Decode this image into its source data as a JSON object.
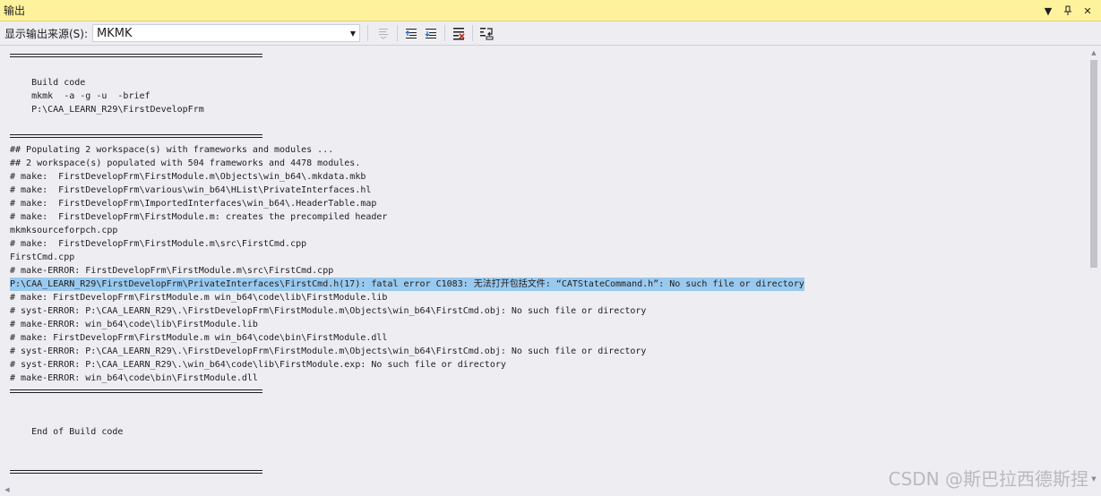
{
  "window": {
    "title": "输出",
    "controls": [
      "▼",
      "ᴨ",
      "✕"
    ]
  },
  "toolbar": {
    "source_label": "显示输出来源(S):",
    "source_value": "MKMK"
  },
  "output": {
    "lines": [
      {
        "type": "rule"
      },
      {
        "type": "blank"
      },
      {
        "type": "text",
        "text": "    Build code"
      },
      {
        "type": "text",
        "text": "    mkmk  -a -g -u  -brief"
      },
      {
        "type": "text",
        "text": "    P:\\CAA_LEARN_R29\\FirstDevelopFrm"
      },
      {
        "type": "blank"
      },
      {
        "type": "rule"
      },
      {
        "type": "text",
        "text": "## Populating 2 workspace(s) with frameworks and modules ..."
      },
      {
        "type": "text",
        "text": "## 2 workspace(s) populated with 504 frameworks and 4478 modules."
      },
      {
        "type": "text",
        "text": "# make:  FirstDevelopFrm\\FirstModule.m\\Objects\\win_b64\\.mkdata.mkb"
      },
      {
        "type": "text",
        "text": "# make:  FirstDevelopFrm\\various\\win_b64\\HList\\PrivateInterfaces.hl"
      },
      {
        "type": "text",
        "text": "# make:  FirstDevelopFrm\\ImportedInterfaces\\win_b64\\.HeaderTable.map"
      },
      {
        "type": "text",
        "text": "# make:  FirstDevelopFrm\\FirstModule.m: creates the precompiled header"
      },
      {
        "type": "text",
        "text": "mkmksourceforpch.cpp"
      },
      {
        "type": "text",
        "text": "# make:  FirstDevelopFrm\\FirstModule.m\\src\\FirstCmd.cpp"
      },
      {
        "type": "text",
        "text": "FirstCmd.cpp"
      },
      {
        "type": "text",
        "text": "# make-ERROR: FirstDevelopFrm\\FirstModule.m\\src\\FirstCmd.cpp"
      },
      {
        "type": "highlight",
        "text": "P:\\CAA_LEARN_R29\\FirstDevelopFrm\\PrivateInterfaces\\FirstCmd.h(17): fatal error C1083: 无法打开包括文件: “CATStateCommand.h”: No such file or directory"
      },
      {
        "type": "text",
        "text": "# make: FirstDevelopFrm\\FirstModule.m win_b64\\code\\lib\\FirstModule.lib"
      },
      {
        "type": "text",
        "text": "# syst-ERROR: P:\\CAA_LEARN_R29\\.\\FirstDevelopFrm\\FirstModule.m\\Objects\\win_b64\\FirstCmd.obj: No such file or directory"
      },
      {
        "type": "text",
        "text": "# make-ERROR: win_b64\\code\\lib\\FirstModule.lib"
      },
      {
        "type": "text",
        "text": "# make: FirstDevelopFrm\\FirstModule.m win_b64\\code\\bin\\FirstModule.dll"
      },
      {
        "type": "text",
        "text": "# syst-ERROR: P:\\CAA_LEARN_R29\\.\\FirstDevelopFrm\\FirstModule.m\\Objects\\win_b64\\FirstCmd.obj: No such file or directory"
      },
      {
        "type": "text",
        "text": "# syst-ERROR: P:\\CAA_LEARN_R29\\.\\win_b64\\code\\lib\\FirstModule.exp: No such file or directory"
      },
      {
        "type": "text",
        "text": "# make-ERROR: win_b64\\code\\bin\\FirstModule.dll"
      },
      {
        "type": "rule"
      },
      {
        "type": "blank"
      },
      {
        "type": "blank"
      },
      {
        "type": "text",
        "text": "    End of Build code"
      },
      {
        "type": "blank"
      },
      {
        "type": "blank"
      },
      {
        "type": "rule"
      }
    ]
  },
  "watermark": "CSDN @斯巴拉西德斯捏",
  "colors": {
    "titlebar_bg": "#fff29d",
    "pane_bg": "#eeeef2",
    "highlight": "#99c9ef"
  }
}
